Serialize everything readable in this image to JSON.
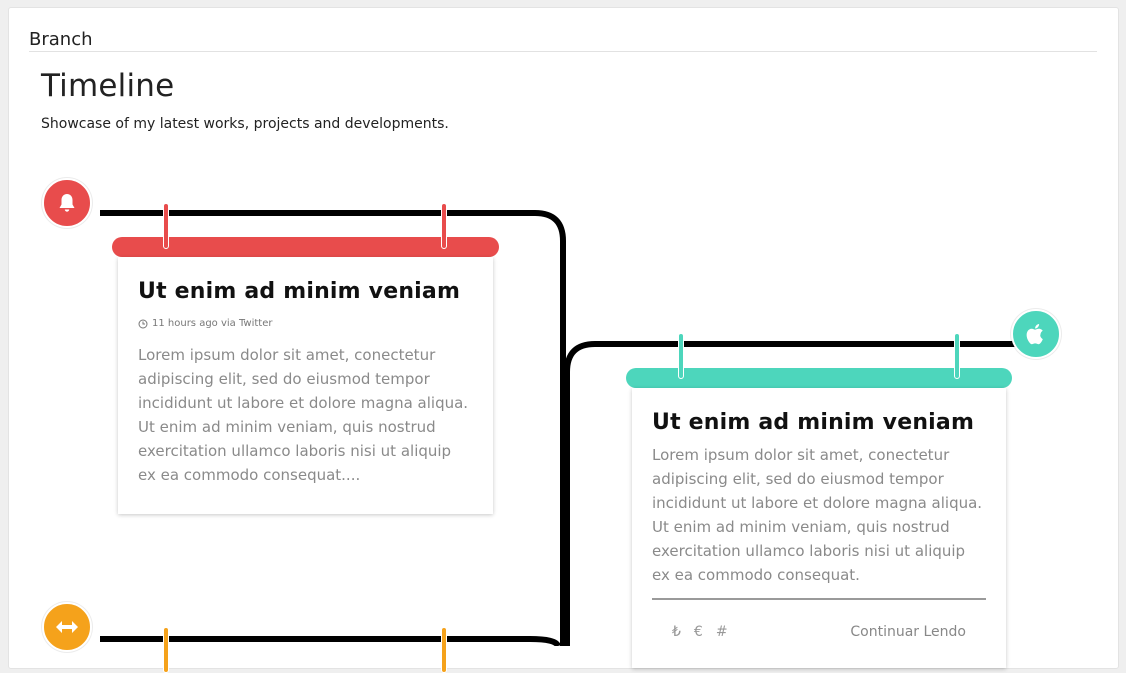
{
  "panel": {
    "title": "Branch"
  },
  "header": {
    "title": "Timeline",
    "subtitle": "Showcase of my latest works, projects and developments."
  },
  "colors": {
    "red": "#e84c4c",
    "teal": "#4dd6bc",
    "orange": "#f5a21b",
    "line": "#000000"
  },
  "nodes": [
    {
      "icon": "bell-icon",
      "color": "#e84c4c"
    },
    {
      "icon": "apple-icon",
      "color": "#4dd6bc"
    },
    {
      "icon": "arrows-horizontal-icon",
      "color": "#f5a21b"
    }
  ],
  "cards": [
    {
      "title": "Ut enim ad minim veniam",
      "meta": "11 hours ago via Twitter",
      "body": "Lorem ipsum dolor sit amet, conectetur adipiscing elit, sed do eiusmod tempor incididunt ut labore et dolore magna aliqua. Ut enim ad minim veniam, quis nostrud exercitation ullamco laboris nisi ut aliquip ex ea commodo consequat...."
    },
    {
      "title": "Ut enim ad minim veniam",
      "body": "Lorem ipsum dolor sit amet, conectetur adipiscing elit, sed do eiusmod tempor incididunt ut labore et dolore magna aliqua. Ut enim ad minim veniam, quis nostrud exercitation ullamco laboris nisi ut aliquip ex ea commodo consequat.",
      "footer_icons": [
        "₺",
        "€",
        "#"
      ],
      "footer_link": "Continuar Lendo"
    }
  ]
}
